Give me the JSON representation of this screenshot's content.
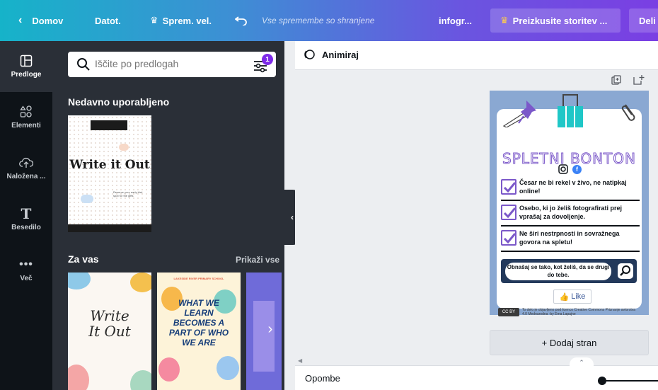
{
  "topbar": {
    "home": "Domov",
    "file": "Datot.",
    "resize": "Sprem. vel.",
    "saved": "Vse spremembe so shranjene",
    "doc_title": "infogr...",
    "try_pro": "Preizkusite storitev ...",
    "share": "Deli"
  },
  "rail": {
    "items": [
      {
        "label": "Predloge",
        "icon": "template-icon"
      },
      {
        "label": "Elementi",
        "icon": "elements-icon"
      },
      {
        "label": "Naložena ...",
        "icon": "upload-icon"
      },
      {
        "label": "Besedilo",
        "icon": "text-icon"
      },
      {
        "label": "Več",
        "icon": "more-icon"
      }
    ]
  },
  "panel": {
    "search_placeholder": "Iščite po predlogah",
    "filter_badge": "1",
    "recent_title": "Nedavno uporabljeno",
    "for_you_title": "Za vas",
    "show_all": "Prikaži vse",
    "recent_template": {
      "title": "Write it Out",
      "subtitle": "Reserve your early bird spot for the gifts"
    },
    "templates": [
      {
        "title_line1": "Write",
        "title_line2": "It Out"
      },
      {
        "title": "WHAT WE LEARN BECOMES A PART OF WHO WE ARE",
        "header": "LAKESIDE RIVER PRIMARY SCHOOL"
      }
    ]
  },
  "editor": {
    "animate": "Animiraj",
    "add_page": "+ Dodaj stran",
    "notes": "Opombe"
  },
  "design": {
    "title": "SPLETNI BONTON",
    "rules": [
      "Česar ne bi rekel v živo, ne natipkaj online!",
      "Osebo, ki jo želiš fotografirati prej vprašaj za dovoljenje.",
      "Ne širi nestrpnosti in sovražnega govora na spletu!"
    ],
    "callout": "Obnašaj se tako, kot želiš, da se drugi do tebe.",
    "like": "Like",
    "cc": "CC BY",
    "license": "To delo je objavljeno pod licenco Creative Commons Priznanje avtorstva 4.0 Mednarodna -by Ema Lapajne"
  },
  "colors": {
    "accent": "#7d2ae8",
    "rail_bg": "#0e1318",
    "panel_bg": "#2a2f37",
    "design_bg": "#8aa8d2",
    "design_purple": "#7b58c9"
  }
}
